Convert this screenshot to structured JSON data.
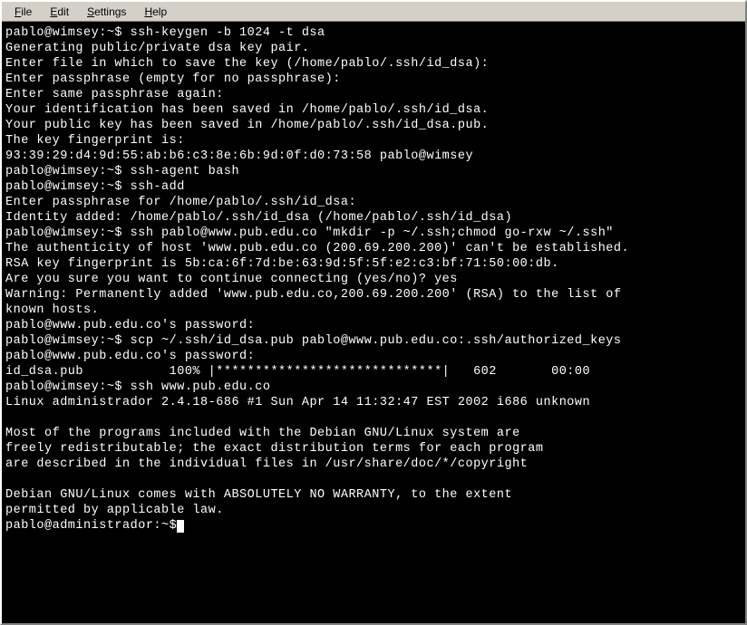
{
  "menu": {
    "file": "File",
    "edit": "Edit",
    "settings": "Settings",
    "help": "Help"
  },
  "terminal": {
    "lines": [
      "pablo@wimsey:~$ ssh-keygen -b 1024 -t dsa",
      "Generating public/private dsa key pair.",
      "Enter file in which to save the key (/home/pablo/.ssh/id_dsa):",
      "Enter passphrase (empty for no passphrase):",
      "Enter same passphrase again:",
      "Your identification has been saved in /home/pablo/.ssh/id_dsa.",
      "Your public key has been saved in /home/pablo/.ssh/id_dsa.pub.",
      "The key fingerprint is:",
      "93:39:29:d4:9d:55:ab:b6:c3:8e:6b:9d:0f:d0:73:58 pablo@wimsey",
      "pablo@wimsey:~$ ssh-agent bash",
      "pablo@wimsey:~$ ssh-add",
      "Enter passphrase for /home/pablo/.ssh/id_dsa:",
      "Identity added: /home/pablo/.ssh/id_dsa (/home/pablo/.ssh/id_dsa)",
      "pablo@wimsey:~$ ssh pablo@www.pub.edu.co \"mkdir -p ~/.ssh;chmod go-rxw ~/.ssh\"",
      "The authenticity of host 'www.pub.edu.co (200.69.200.200)' can't be established.",
      "RSA key fingerprint is 5b:ca:6f:7d:be:63:9d:5f:5f:e2:c3:bf:71:50:00:db.",
      "Are you sure you want to continue connecting (yes/no)? yes",
      "Warning: Permanently added 'www.pub.edu.co,200.69.200.200' (RSA) to the list of",
      "known hosts.",
      "pablo@www.pub.edu.co's password:",
      "pablo@wimsey:~$ scp ~/.ssh/id_dsa.pub pablo@www.pub.edu.co:.ssh/authorized_keys",
      "pablo@www.pub.edu.co's password:",
      "id_dsa.pub           100% |*****************************|   602       00:00",
      "pablo@wimsey:~$ ssh www.pub.edu.co",
      "Linux administrador 2.4.18-686 #1 Sun Apr 14 11:32:47 EST 2002 i686 unknown",
      "",
      "Most of the programs included with the Debian GNU/Linux system are",
      "freely redistributable; the exact distribution terms for each program",
      "are described in the individual files in /usr/share/doc/*/copyright",
      "",
      "Debian GNU/Linux comes with ABSOLUTELY NO WARRANTY, to the extent",
      "permitted by applicable law.",
      "pablo@administrador:~$"
    ]
  }
}
